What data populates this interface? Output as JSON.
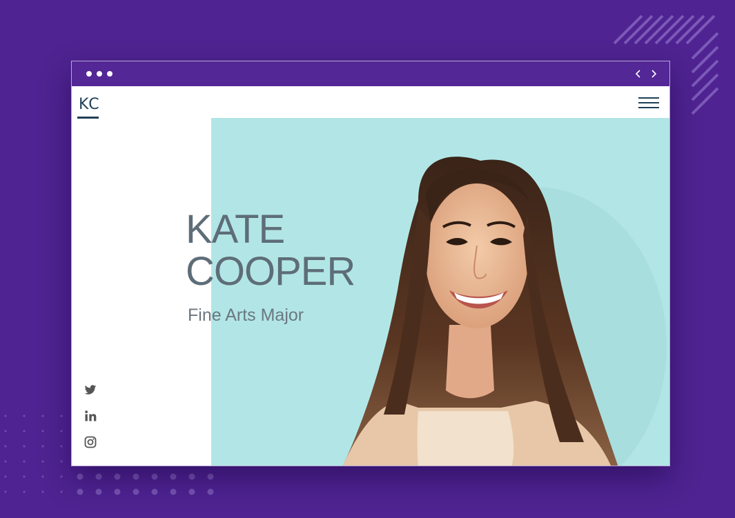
{
  "window": {
    "controls": [
      "dot",
      "dot",
      "dot"
    ],
    "nav": {
      "back_icon": "chevron-left-icon",
      "forward_icon": "chevron-right-icon"
    }
  },
  "site": {
    "logo": "KC",
    "menu_icon": "hamburger-menu-icon"
  },
  "hero": {
    "first_name": "KATE",
    "last_name": "COOPER",
    "subtitle": "Fine Arts Major",
    "background_color": "#b2e6e6"
  },
  "social": [
    {
      "name": "twitter",
      "icon": "twitter-icon"
    },
    {
      "name": "linkedin",
      "icon": "linkedin-icon"
    },
    {
      "name": "instagram",
      "icon": "instagram-icon"
    }
  ],
  "colors": {
    "page_background": "#4f2391",
    "accent_dark": "#1f3f55",
    "text_gray": "#5e6d78"
  }
}
